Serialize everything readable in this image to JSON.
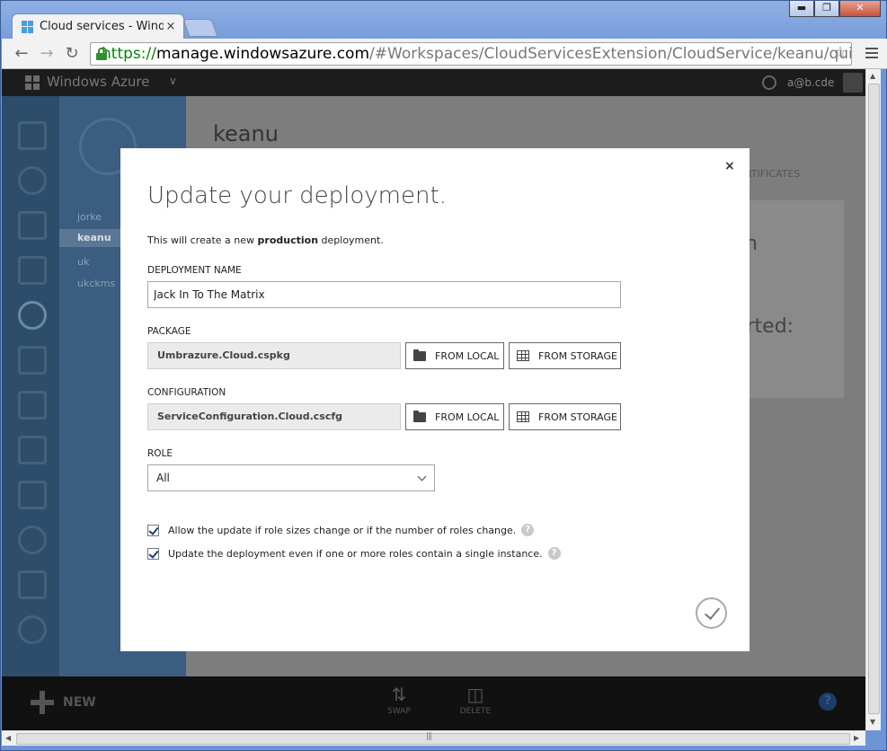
{
  "browser": {
    "tab_title": "Cloud services - Windows Azure",
    "tab_close": "×",
    "url_scheme": "https://",
    "url_host": "manage.windowsazure.com",
    "url_path": "/#Workspaces/CloudServicesExtension/CloudService/keanu/quickstart",
    "window_buttons": [
      "▬",
      "❐",
      "✕"
    ]
  },
  "portal": {
    "brand": "Windows Azure",
    "user": "a@b.cde",
    "subnav_items": [
      "jorke",
      "keanu",
      "uk",
      "ukckms"
    ],
    "selected_item": "keanu",
    "content_title": "keanu",
    "content_tab": "RTIFICATES",
    "content_text_1": "n",
    "content_text_2": "arted:",
    "bottom_new": "NEW",
    "bottom_swap": "SWAP",
    "bottom_delete": "DELETE",
    "help": "?"
  },
  "dialog": {
    "title": "Update your deployment.",
    "desc_prefix": "This will create a new ",
    "desc_bold": "production",
    "desc_suffix": " deployment.",
    "deployment_name_label": "DEPLOYMENT NAME",
    "deployment_name_value": "Jack In To The Matrix",
    "package_label": "PACKAGE",
    "package_value": "Umbrazure.Cloud.cspkg",
    "configuration_label": "CONFIGURATION",
    "configuration_value": "ServiceConfiguration.Cloud.cscfg",
    "from_local": "FROM LOCAL",
    "from_storage": "FROM STORAGE",
    "role_label": "ROLE",
    "role_value": "All",
    "check_1": "Allow the update if role sizes change or if the number of roles change.",
    "check_2": "Update the deployment even if one or more roles contain a single instance.",
    "close": "×",
    "info": "?"
  }
}
